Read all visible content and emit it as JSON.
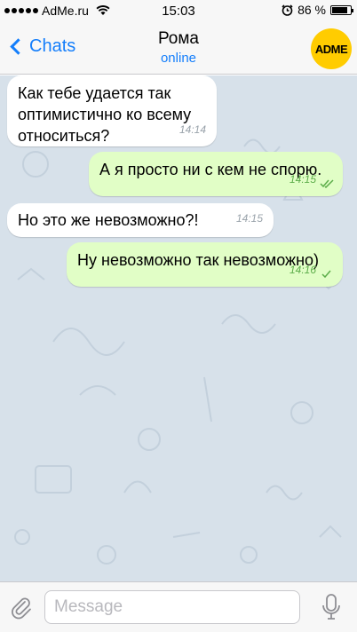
{
  "status": {
    "carrier": "AdMe.ru",
    "time": "15:03",
    "battery_text": "86 %",
    "battery_level": 0.86
  },
  "nav": {
    "back_label": "Chats",
    "title": "Рома",
    "subtitle": "online",
    "avatar_text": "ADME"
  },
  "messages": [
    {
      "side": "in",
      "text": "Как тебе удается так оптимистично ко всему относиться?",
      "time": "14:14"
    },
    {
      "side": "out",
      "text": "А я просто ни с кем не спорю.",
      "time": "14:15",
      "read": true
    },
    {
      "side": "in",
      "text": "Но это же невозможно?!",
      "time": "14:15"
    },
    {
      "side": "out",
      "text": "Ну невозможно так невозможно)",
      "time": "14:16",
      "read": false
    }
  ],
  "input": {
    "placeholder": "Message"
  },
  "colors": {
    "accent": "#147efb",
    "outgoing_bubble": "#e1fec6",
    "incoming_bubble": "#ffffff",
    "chat_background": "#d7e1ea",
    "avatar": "#ffcc00"
  },
  "icons": {
    "wifi": "wifi-icon",
    "alarm": "alarm-icon",
    "back": "chevron-left-icon",
    "attach": "paperclip-icon",
    "mic": "microphone-icon",
    "read": "double-check-icon",
    "sent": "check-icon"
  }
}
